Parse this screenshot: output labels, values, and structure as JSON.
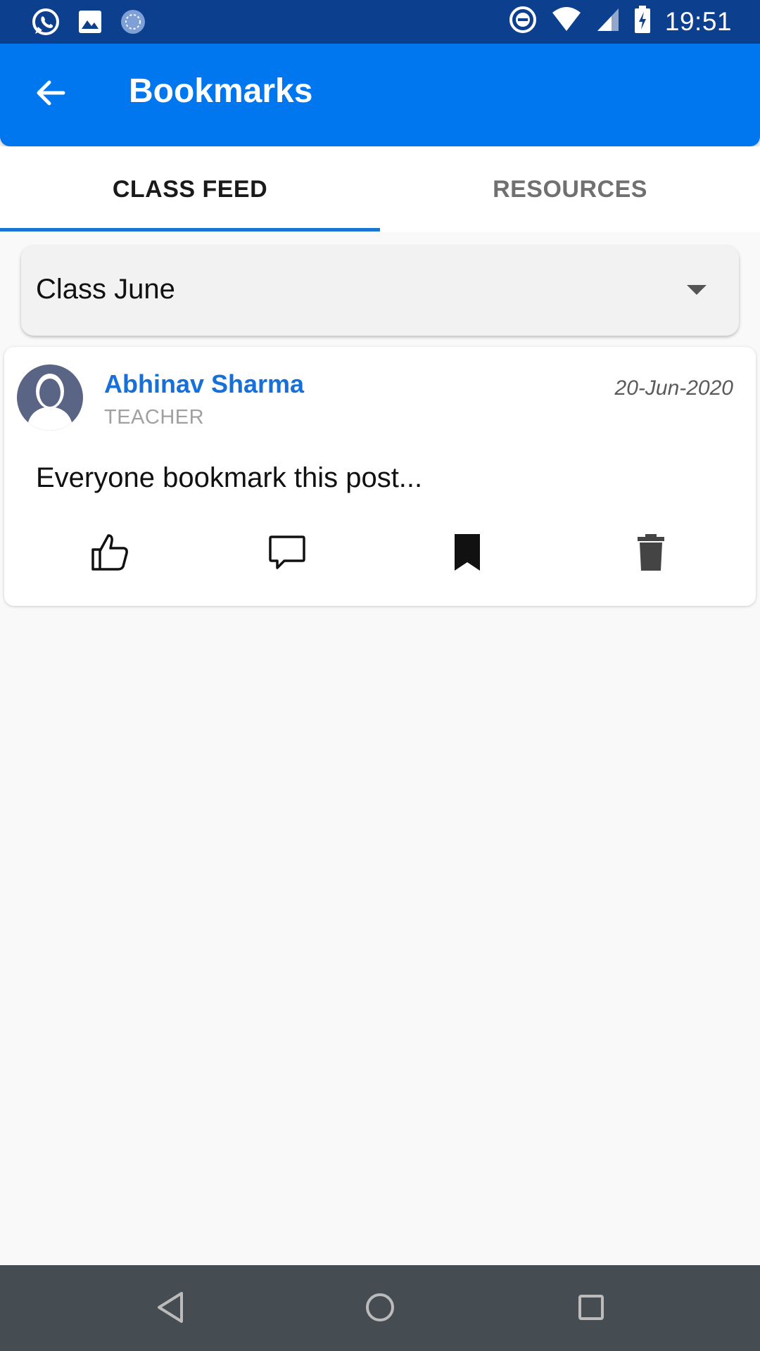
{
  "status_bar": {
    "time": "19:51",
    "icons": [
      "whatsapp-icon",
      "gallery-icon",
      "sync-icon",
      "dnd-icon",
      "wifi-icon",
      "signal-icon",
      "battery-charging-icon"
    ]
  },
  "app_bar": {
    "title": "Bookmarks",
    "back_icon": "arrow-left-icon",
    "color": "#0077ee"
  },
  "tabs": [
    {
      "label": "CLASS FEED",
      "active": true
    },
    {
      "label": "RESOURCES",
      "active": false
    }
  ],
  "class_select": {
    "value": "Class June"
  },
  "posts": [
    {
      "author": "Abhinav Sharma",
      "role": "TEACHER",
      "date": "20-Jun-2020",
      "text": "Everyone bookmark this post...",
      "actions": [
        "like-icon",
        "comment-icon",
        "bookmark-icon",
        "delete-icon"
      ],
      "bookmarked": true
    }
  ],
  "nav_bar": {
    "buttons": [
      "back-triangle-icon",
      "home-circle-icon",
      "recents-square-icon"
    ]
  }
}
